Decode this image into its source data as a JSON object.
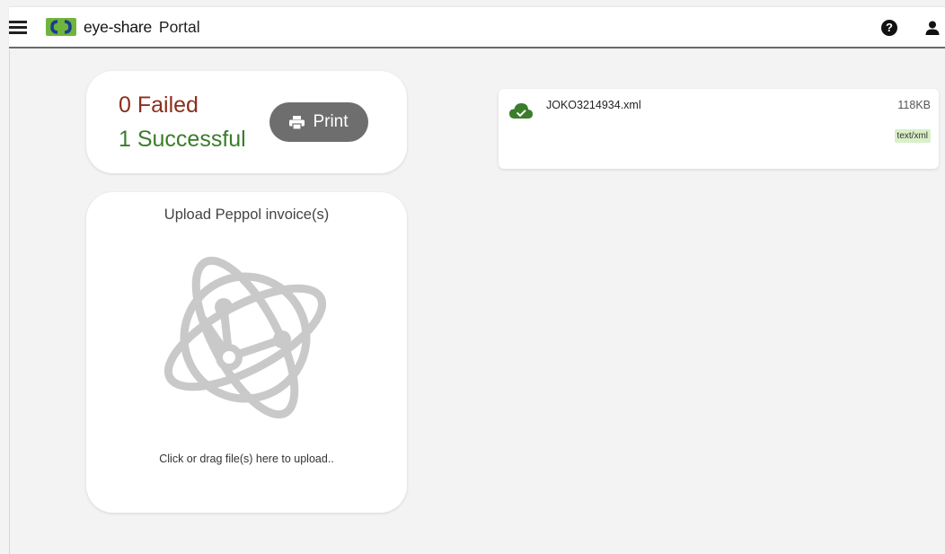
{
  "header": {
    "brand_name": "eye-share",
    "brand_suffix": "Portal",
    "icons": [
      "menu-icon",
      "logo-icon",
      "help-icon",
      "user-icon"
    ]
  },
  "status": {
    "failed_text": "0 Failed",
    "success_text": "1 Successful",
    "print_label": "Print",
    "colors": {
      "failed": "#8b2e1c",
      "success": "#3a7d2a",
      "button": "#6e6e6e"
    }
  },
  "upload": {
    "title": "Upload Peppol invoice(s)",
    "hint": "Click or drag file(s) here to upload.."
  },
  "files": [
    {
      "name": "JOKO3214934.xml",
      "size": "118KB",
      "mime": "text/xml",
      "status_icon": "cloud-check-icon",
      "status_color": "#3a7d2a"
    }
  ],
  "theme": {
    "accent_green": "#6fb53d",
    "logo_blue": "#1c3d8f"
  }
}
